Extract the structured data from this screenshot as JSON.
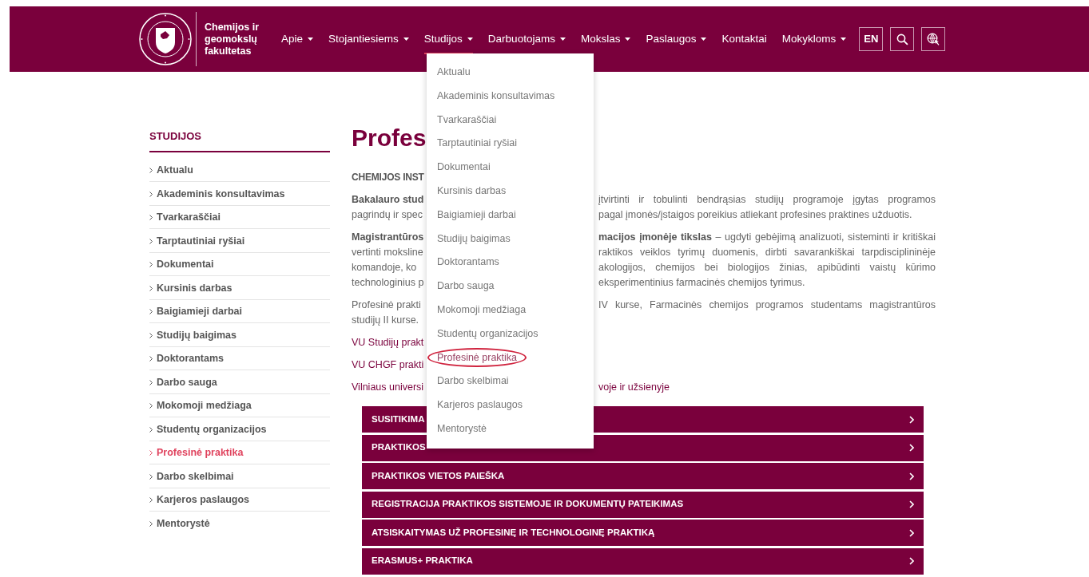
{
  "header": {
    "faculty_name": "Chemijos ir geomokslų fakultetas",
    "nav": [
      {
        "label": "Apie",
        "caret": true,
        "selected": false
      },
      {
        "label": "Stojantiesiems",
        "caret": true,
        "selected": false
      },
      {
        "label": "Studijos",
        "caret": true,
        "selected": true
      },
      {
        "label": "Darbuotojams",
        "caret": true,
        "selected": false
      },
      {
        "label": "Mokslas",
        "caret": true,
        "selected": false
      },
      {
        "label": "Paslaugos",
        "caret": true,
        "selected": false
      },
      {
        "label": "Kontaktai",
        "caret": false,
        "selected": false
      },
      {
        "label": "Mokykloms",
        "caret": true,
        "selected": false
      }
    ],
    "language_button": "EN"
  },
  "sidebar": {
    "title": "STUDIJOS",
    "items": [
      {
        "label": "Aktualu",
        "selected": false
      },
      {
        "label": "Akademinis konsultavimas",
        "selected": false
      },
      {
        "label": "Tvarkaraščiai",
        "selected": false
      },
      {
        "label": "Tarptautiniai ryšiai",
        "selected": false
      },
      {
        "label": "Dokumentai",
        "selected": false
      },
      {
        "label": "Kursinis darbas",
        "selected": false
      },
      {
        "label": "Baigiamieji darbai",
        "selected": false
      },
      {
        "label": "Studijų baigimas",
        "selected": false
      },
      {
        "label": "Doktorantams",
        "selected": false
      },
      {
        "label": "Darbo sauga",
        "selected": false
      },
      {
        "label": "Mokomoji medžiaga",
        "selected": false
      },
      {
        "label": "Studentų organizacijos",
        "selected": false
      },
      {
        "label": "Profesinė praktika",
        "selected": true
      },
      {
        "label": "Darbo skelbimai",
        "selected": false
      },
      {
        "label": "Karjeros paslaugos",
        "selected": false
      },
      {
        "label": "Mentorystė",
        "selected": false
      }
    ]
  },
  "content": {
    "title": "Profes",
    "paragraphs": [
      {
        "lines": [
          {
            "kind": "subheading",
            "left": "CHEMIJOS INST"
          }
        ]
      },
      {
        "lines": [
          {
            "kind": "text",
            "left": "Bakalauro stud",
            "left_bold": true,
            "right": "įtvirtinti ir tobulinti bendrąsias studijų programoje įgytas programos",
            "justified": true
          },
          {
            "kind": "text",
            "left": "pagrindų ir spec",
            "left_bold": false,
            "right": "pagal įmonės/įstaigos poreikius atliekant profesines praktines užduotis.",
            "justified": false
          }
        ]
      },
      {
        "lines": [
          {
            "kind": "text",
            "left": "Magistrantūros",
            "left_bold": true,
            "right": "**macijos įmonėje tikslas** – ugdyti gebėjimą analizuoti, sisteminti ir kritiškai",
            "justified": true
          },
          {
            "kind": "text",
            "left": "vertinti moksline",
            "left_bold": false,
            "right": "raktikos veiklos tyrimų duomenis, dirbti savarankiškai tarpdisciplininėje",
            "justified": true
          },
          {
            "kind": "text",
            "left": "komandoje, ko",
            "left_bold": false,
            "right": "akologijos, chemijos bei biologijos žinias, apibūdinti vaistų kūrimo",
            "justified": true
          },
          {
            "kind": "text",
            "left": "technologinius p",
            "left_bold": false,
            "right": "eksperimentinius  farmacinės chemijos tyrimus.",
            "justified": false
          }
        ]
      },
      {
        "lines": [
          {
            "kind": "text",
            "left": "Profesinė prakti",
            "left_bold": false,
            "right": "IV kurse, Farmacinės chemijos programos studentams magistrantūros",
            "justified": true
          },
          {
            "kind": "text",
            "left": "studijų II kurse.",
            "left_bold": false
          }
        ]
      },
      {
        "lines": [
          {
            "kind": "link",
            "left": "VU Studijų prakt"
          }
        ]
      },
      {
        "lines": [
          {
            "kind": "link",
            "left": "VU CHGF prakti"
          }
        ]
      },
      {
        "lines": [
          {
            "kind": "link",
            "left": "Vilniaus universi",
            "right": "voje ir užsienyje"
          }
        ]
      }
    ],
    "accordion": [
      {
        "label": "SUSITIKIMA"
      },
      {
        "label": "PRAKTIKOS"
      },
      {
        "label": "PRAKTIKOS VIETOS PAIEŠKA"
      },
      {
        "label": "REGISTRACIJA PRAKTIKOS SISTEMOJE IR DOKUMENTŲ PATEIKIMAS"
      },
      {
        "label": "ATSISKAITYMAS UŽ PROFESINĘ IR TECHNOLOGINĘ PRAKTIKĄ"
      },
      {
        "label": "ERASMUS+ PRAKTIKA"
      }
    ]
  },
  "dropdown": {
    "items": [
      {
        "label": "Aktualu",
        "selected": false
      },
      {
        "label": "Akademinis konsultavimas",
        "selected": false
      },
      {
        "label": "Tvarkaraščiai",
        "selected": false
      },
      {
        "label": "Tarptautiniai ryšiai",
        "selected": false
      },
      {
        "label": "Dokumentai",
        "selected": false
      },
      {
        "label": "Kursinis darbas",
        "selected": false
      },
      {
        "label": "Baigiamieji darbai",
        "selected": false
      },
      {
        "label": "Studijų baigimas",
        "selected": false
      },
      {
        "label": "Doktorantams",
        "selected": false
      },
      {
        "label": "Darbo sauga",
        "selected": false
      },
      {
        "label": "Mokomoji medžiaga",
        "selected": false
      },
      {
        "label": "Studentų organizacijos",
        "selected": false
      },
      {
        "label": "Profesinė praktika",
        "selected": true
      },
      {
        "label": "Darbo skelbimai",
        "selected": false
      },
      {
        "label": "Karjeros paslaugos",
        "selected": false
      },
      {
        "label": "Mentorystė",
        "selected": false
      }
    ]
  }
}
